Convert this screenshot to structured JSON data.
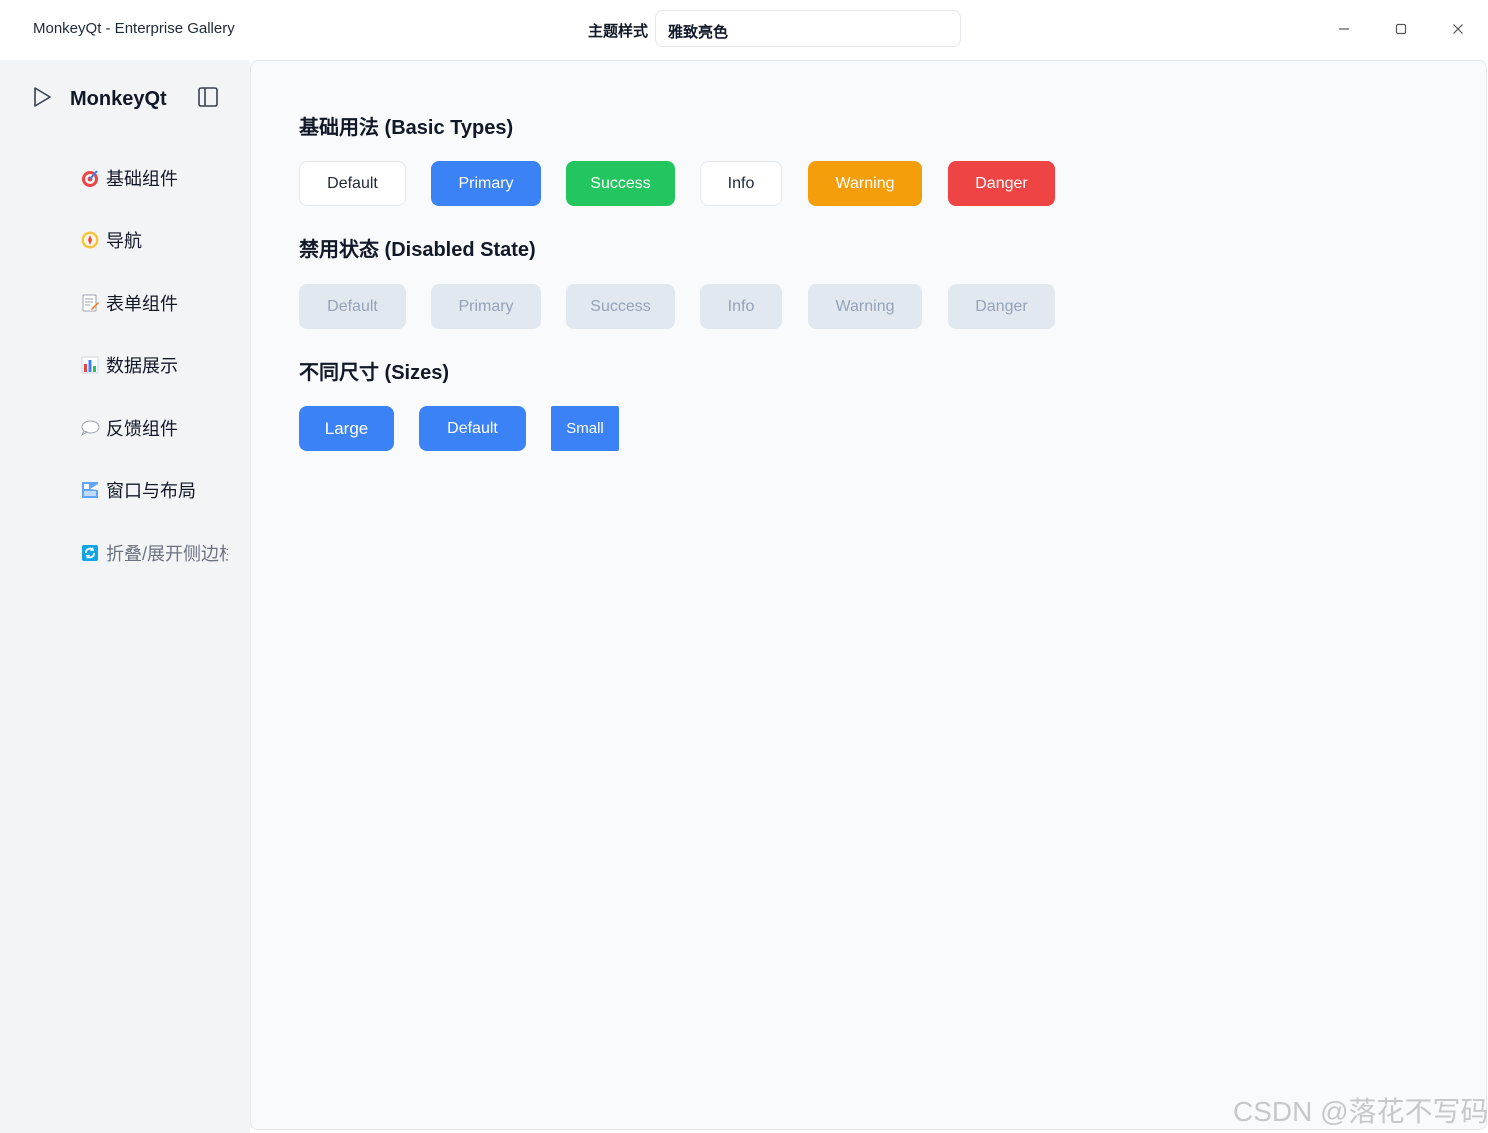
{
  "window": {
    "title": "MonkeyQt - Enterprise Gallery",
    "theme_label": "主题样式",
    "theme_value": "雅致亮色",
    "controls": {
      "minimize": "—",
      "maximize": "☐",
      "close": "✕"
    }
  },
  "sidebar": {
    "brand": "MonkeyQt",
    "items": [
      {
        "label": "基础组件",
        "icon": "target-icon"
      },
      {
        "label": "导航",
        "icon": "compass-icon"
      },
      {
        "label": "表单组件",
        "icon": "memo-icon"
      },
      {
        "label": "数据展示",
        "icon": "bar-chart-icon"
      },
      {
        "label": "反馈组件",
        "icon": "speech-bubble-icon"
      },
      {
        "label": "窗口与布局",
        "icon": "window-icon"
      },
      {
        "label": "折叠/展开侧边栏",
        "icon": "refresh-icon"
      }
    ]
  },
  "main": {
    "basic_title": "基础用法 (Basic Types)",
    "basic_buttons": {
      "default": "Default",
      "primary": "Primary",
      "success": "Success",
      "info": "Info",
      "warning": "Warning",
      "danger": "Danger"
    },
    "disabled_title": "禁用状态 (Disabled State)",
    "disabled_buttons": {
      "default": "Default",
      "primary": "Primary",
      "success": "Success",
      "info": "Info",
      "warning": "Warning",
      "danger": "Danger"
    },
    "sizes_title": "不同尺寸 (Sizes)",
    "size_buttons": {
      "large": "Large",
      "default": "Default",
      "small": "Small"
    }
  },
  "colors": {
    "primary": "#3b82f6",
    "success": "#22c55e",
    "warning": "#f59e0b",
    "danger": "#ef4444",
    "disabled": "#e2e8f0"
  },
  "watermark": "CSDN @落花不写码"
}
